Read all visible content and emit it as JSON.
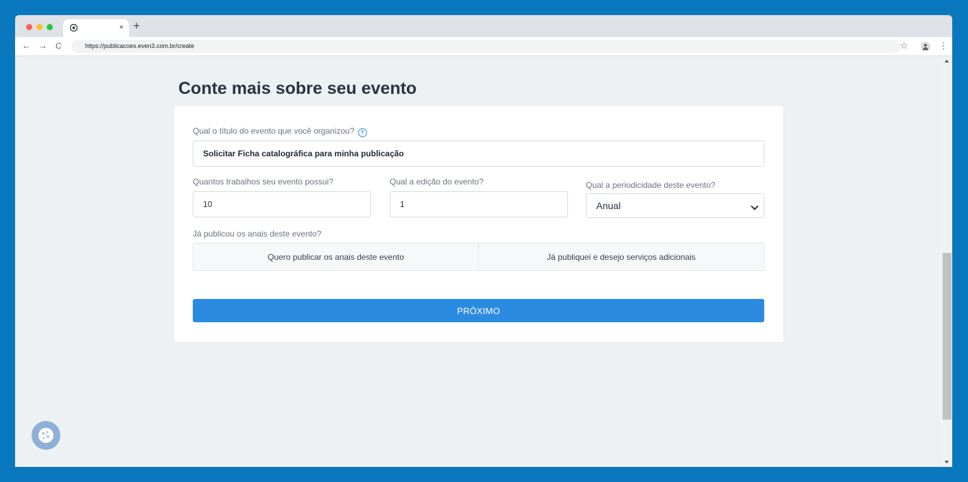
{
  "browser": {
    "tab": {
      "close_glyph": "×",
      "icon": "chrome-icon"
    },
    "new_tab_glyph": "+",
    "nav": {
      "back": "←",
      "forward": "→",
      "reload": "C"
    },
    "url": "https://publicacoes.even3.com.br/create",
    "star_glyph": "☆",
    "menu_glyph": "⋮"
  },
  "page": {
    "title": "Conte mais sobre seu evento"
  },
  "form": {
    "event_title": {
      "label": "Qual o título do evento que você organizou?",
      "help_glyph": "?",
      "value": "Solicitar Ficha catalográfica para minha publicação"
    },
    "works_count": {
      "label": "Quantos trabalhos seu evento possui?",
      "value": "10"
    },
    "edition": {
      "label": "Qual a edição do evento?",
      "value": "1"
    },
    "periodicity": {
      "label": "Qual a periodicidade deste evento?",
      "selected": "Anual"
    },
    "published": {
      "label": "Já publicou os anais deste evento?",
      "options": [
        "Quero publicar os anais deste evento",
        "Já publiquei e desejo serviços adicionais"
      ]
    },
    "next_label": "PRÓXIMO"
  },
  "colors": {
    "background": "#0a78bf",
    "primary_button": "#2b8be0",
    "cookie_button": "#8db0d6"
  }
}
